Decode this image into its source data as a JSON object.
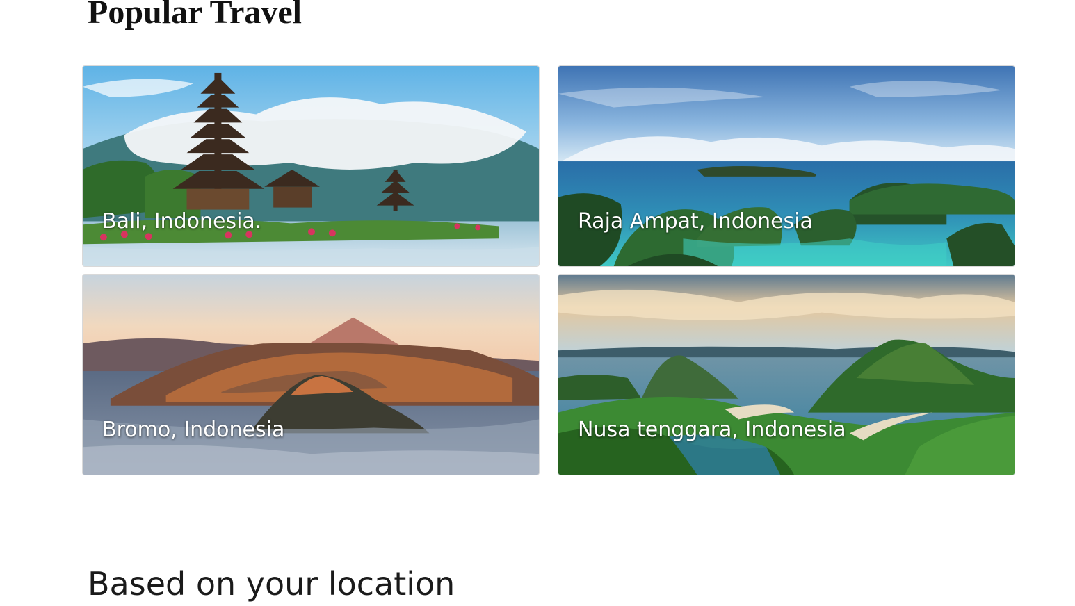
{
  "popular_travel": {
    "title": "Popular Travel",
    "cards": [
      {
        "label": "Bali, Indonesia."
      },
      {
        "label": "Raja Ampat, Indonesia"
      },
      {
        "label": "Bromo, Indonesia"
      },
      {
        "label": "Nusa tenggara, Indonesia"
      }
    ]
  },
  "location_section": {
    "title": "Based on your location"
  }
}
